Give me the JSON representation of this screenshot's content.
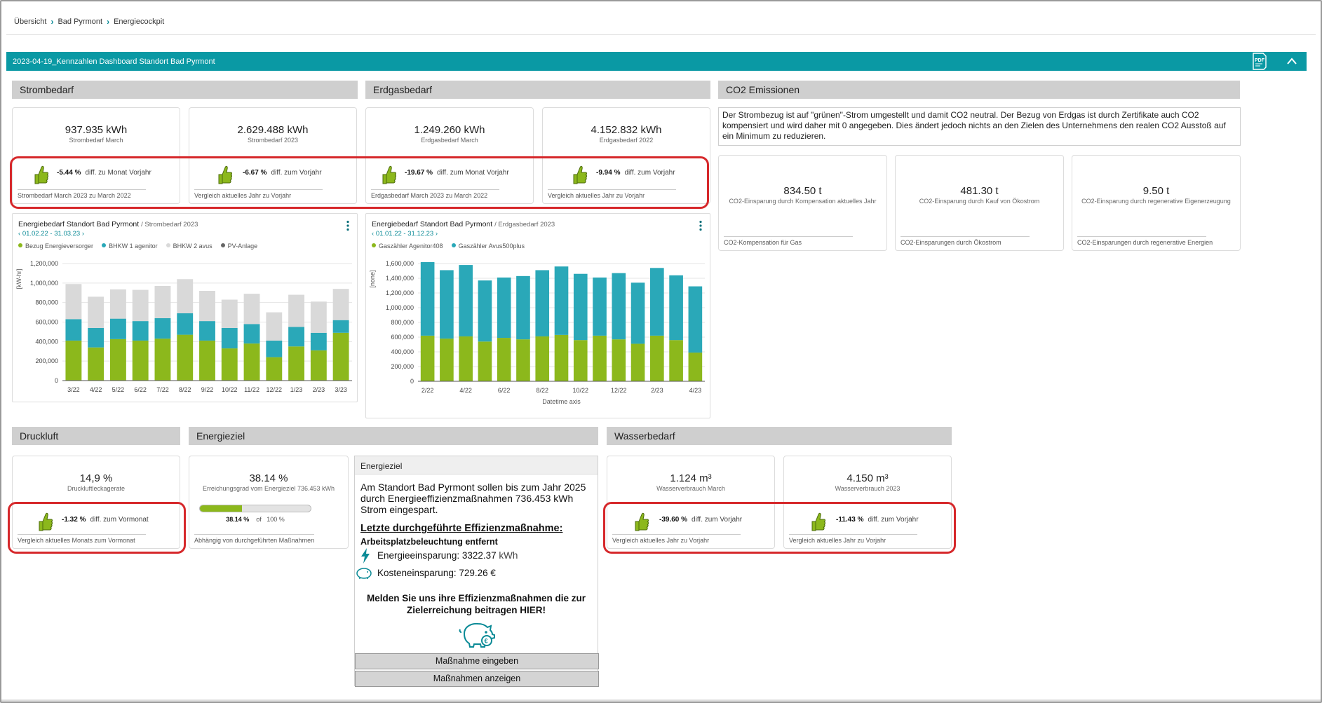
{
  "breadcrumb": [
    "Übersicht",
    "Bad Pyrmont",
    "Energiecockpit"
  ],
  "dashboard_title": "2023-04-19_Kennzahlen Dashboard Standort Bad Pyrmont",
  "icons": {
    "pdf": "pdf-export-icon",
    "collapse": "chevron-up-icon",
    "thumb": "thumbs-up-icon",
    "menu": "kebab-menu-icon",
    "lightning": "lightning-icon",
    "piggy": "piggy-bank-icon"
  },
  "colors": {
    "accent": "#0a99a4",
    "green": "#8cb81c",
    "teal": "#2aa8b8",
    "grey": "#d9d9d9",
    "highlight": "#d6282b"
  },
  "sections": {
    "strom": "Strombedarf",
    "gas": "Erdgasbedarf",
    "co2": "CO2 Emissionen",
    "druckluft": "Druckluft",
    "energieziel": "Energieziel",
    "wasser": "Wasserbedarf"
  },
  "kpis": {
    "strom_month": {
      "value": "937.935 kWh",
      "label": "Strombedarf March",
      "diff": "-5.44 %",
      "diff_text": "diff. zu Monat Vorjahr",
      "footer": "Strombedarf March 2023 zu March 2022"
    },
    "strom_year": {
      "value": "2.629.488 kWh",
      "label": "Strombedarf 2023",
      "diff": "-6.67 %",
      "diff_text": "diff. zum Vorjahr",
      "footer": "Vergleich aktuelles Jahr zu Vorjahr"
    },
    "gas_month": {
      "value": "1.249.260 kWh",
      "label": "Erdgasbedarf March",
      "diff": "-19.67 %",
      "diff_text": "diff. zum Monat Vorjahr",
      "footer": "Erdgasbedarf March 2023 zu March 2022"
    },
    "gas_year": {
      "value": "4.152.832 kWh",
      "label": "Erdgasbedarf 2022",
      "diff": "-9.94 %",
      "diff_text": "diff. zum Vorjahr",
      "footer": "Vergleich aktuelles Jahr zu Vorjahr"
    },
    "druck": {
      "value": "14,9 %",
      "label": "Druckluftleckagerate",
      "diff": "-1.32 %",
      "diff_text": "diff. zum Vormonat",
      "footer": "Vergleich aktuelles Monats zum Vormonat"
    },
    "ziel": {
      "value": "38.14 %",
      "label": "Erreichungsgrad vom Energieziel 736.453 kWh",
      "progress": 38.14,
      "progress_label": "38.14 %",
      "progress_of": "of",
      "progress_max": "100 %",
      "footer": "Abhängig von durchgeführten Maßnahmen"
    },
    "wasser_month": {
      "value": "1.124 m³",
      "label": "Wasserverbrauch March",
      "diff": "-39.60 %",
      "diff_text": "diff. zum Vorjahr",
      "footer": "Vergleich aktuelles Jahr zu Vorjahr"
    },
    "wasser_year": {
      "value": "4.150 m³",
      "label": "Wasserverbrauch 2023",
      "diff": "-11.43 %",
      "diff_text": "diff. zum Vorjahr",
      "footer": "Vergleich aktuelles Jahr zu Vorjahr"
    }
  },
  "co2": {
    "text": "Der Strombezug ist  auf \"grünen\"-Strom umgestellt und damit CO2 neutral. Der Bezug von Erdgas ist durch Zertifikate auch CO2 kompensiert und wird daher mit 0 angegeben. Dies ändert jedoch nichts an den Zielen des Unternehmens den realen CO2 Ausstoß auf ein Minimum zu reduzieren.",
    "cards": [
      {
        "value": "834.50 t",
        "label": "CO2-Einsparung durch Kompensation aktuelles Jahr",
        "footer": "CO2-Kompensation für Gas"
      },
      {
        "value": "481.30 t",
        "label": "CO2-Einsparung durch Kauf von Ökostrom",
        "footer": "CO2-Einsparungen durch Ökostrom"
      },
      {
        "value": "9.50 t",
        "label": "CO2-Einsparung durch regenerative Eigenerzeugung",
        "footer": "CO2-Einsparungen durch regenerative Energien"
      }
    ]
  },
  "energieziel_panel": {
    "header": "Energieziel",
    "text": "Am Standort Bad Pyrmont sollen bis zum Jahr 2025 durch Energieeffizienzmaßnahmen  736.453 kWh Strom eingespart.",
    "heading": "Letzte durchgeführte Effizienzmaßnahme:",
    "measure": "Arbeitsplatzbeleuchtung entfernt",
    "saving_label": "Energieeinsparung: 3322.37",
    "saving_unit": "kWh",
    "cost_label": "Kosteneinsparung: 729.26 €",
    "call": "Melden Sie uns ihre Effizienzmaßnahmen die zur Zielerreichung beitragen HIER!",
    "button_enter": "Maßnahme eingeben",
    "button_show": "Maßnahmen anzeigen"
  },
  "chart_data": [
    {
      "type": "bar",
      "stacked": true,
      "title": "Energiebedarf Standort Bad Pyrmont",
      "subtitle": "/ Strombedarf 2023",
      "range": "01.02.22 - 31.03.23",
      "ylabel": "[kW-hr]",
      "ylim": [
        0,
        1200000
      ],
      "yticks": [
        "0",
        "200,000",
        "400,000",
        "600,000",
        "800,000",
        "1,000,000",
        "1,200,000"
      ],
      "categories": [
        "3/22",
        "4/22",
        "5/22",
        "6/22",
        "7/22",
        "8/22",
        "9/22",
        "10/22",
        "11/22",
        "12/22",
        "1/23",
        "2/23",
        "3/23"
      ],
      "series": [
        {
          "name": "Bezug Energieversorger",
          "color": "#8cb81c",
          "values": [
            410000,
            340000,
            425000,
            410000,
            430000,
            470000,
            410000,
            330000,
            380000,
            240000,
            350000,
            310000,
            490000
          ]
        },
        {
          "name": "BHKW 1 agenitor",
          "color": "#2aa8b8",
          "values": [
            220000,
            200000,
            210000,
            200000,
            210000,
            220000,
            200000,
            210000,
            200000,
            170000,
            200000,
            180000,
            130000
          ]
        },
        {
          "name": "BHKW 2 avus",
          "color": "#d9d9d9",
          "values": [
            360000,
            320000,
            300000,
            320000,
            330000,
            350000,
            310000,
            290000,
            310000,
            290000,
            330000,
            320000,
            320000
          ]
        },
        {
          "name": "PV-Anlage",
          "color": "#666666",
          "values": [
            0,
            0,
            0,
            0,
            0,
            0,
            0,
            0,
            0,
            0,
            0,
            0,
            0
          ]
        }
      ]
    },
    {
      "type": "bar",
      "stacked": true,
      "title": "Energiebedarf Standort Bad Pyrmont",
      "subtitle": "/ Erdgasbedarf 2023",
      "range": "01.01.22 - 31.12.23",
      "ylabel": "[none]",
      "xlabel": "Datetime axis",
      "ylim": [
        0,
        1600000
      ],
      "yticks": [
        "0",
        "200,000",
        "400,000",
        "600,000",
        "800,000",
        "1,000,000",
        "1,200,000",
        "1,400,000",
        "1,600,000"
      ],
      "categories": [
        "2/22",
        "3/22",
        "4/22",
        "5/22",
        "6/22",
        "7/22",
        "8/22",
        "9/22",
        "10/22",
        "11/22",
        "12/22",
        "1/23",
        "2/23",
        "3/23",
        "4/23"
      ],
      "xticks": [
        "2/22",
        "4/22",
        "6/22",
        "8/22",
        "10/22",
        "12/22",
        "2/23",
        "4/23"
      ],
      "series": [
        {
          "name": "Gaszähler Agenitor408",
          "color": "#8cb81c",
          "values": [
            620000,
            580000,
            610000,
            540000,
            590000,
            570000,
            610000,
            630000,
            560000,
            620000,
            570000,
            510000,
            620000,
            560000,
            390000
          ]
        },
        {
          "name": "Gaszähler Avus500plus",
          "color": "#2aa8b8",
          "values": [
            1000000,
            930000,
            970000,
            830000,
            820000,
            860000,
            900000,
            930000,
            900000,
            790000,
            900000,
            830000,
            920000,
            880000,
            900000
          ]
        }
      ]
    }
  ]
}
